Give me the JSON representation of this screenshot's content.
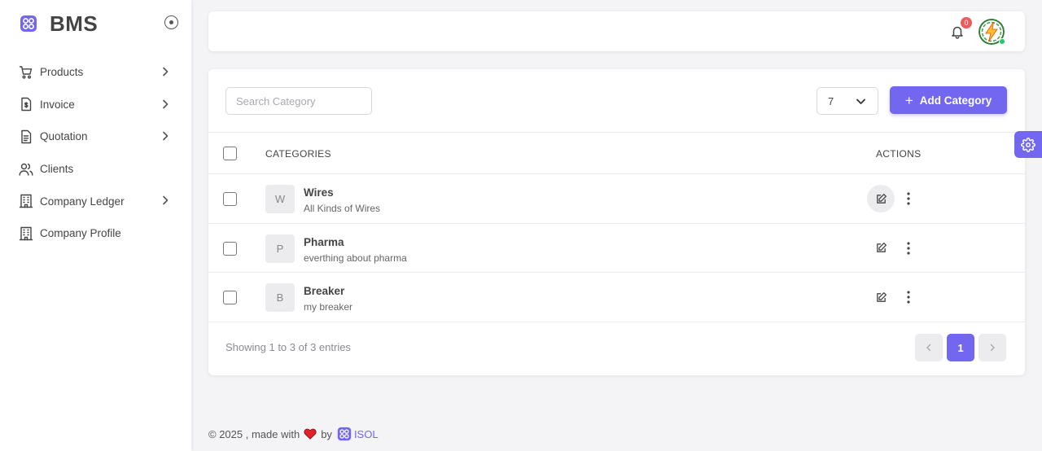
{
  "brand": {
    "name": "BMS"
  },
  "colors": {
    "primary": "#7367f0",
    "danger": "#ef5b5b",
    "success": "#28c76f"
  },
  "sidebar": {
    "items": [
      {
        "label": "Products",
        "icon": "cart-icon",
        "has_submenu": true
      },
      {
        "label": "Invoice",
        "icon": "invoice-icon",
        "has_submenu": true
      },
      {
        "label": "Quotation",
        "icon": "document-icon",
        "has_submenu": true
      },
      {
        "label": "Clients",
        "icon": "users-icon",
        "has_submenu": false
      },
      {
        "label": "Company Ledger",
        "icon": "building-icon",
        "has_submenu": true
      },
      {
        "label": "Company Profile",
        "icon": "building-icon",
        "has_submenu": false
      }
    ]
  },
  "header": {
    "notification_count": "0"
  },
  "toolbar": {
    "search_placeholder": "Search Category",
    "page_size": "7",
    "add_label": "Add Category"
  },
  "table": {
    "columns": {
      "categories": "CATEGORIES",
      "actions": "ACTIONS"
    },
    "rows": [
      {
        "initial": "W",
        "name": "Wires",
        "description": "All Kinds of Wires"
      },
      {
        "initial": "P",
        "name": "Pharma",
        "description": "everthing about pharma"
      },
      {
        "initial": "B",
        "name": "Breaker",
        "description": "my breaker"
      }
    ]
  },
  "pagination": {
    "summary": "Showing 1 to 3 of 3 entries",
    "current_page": "1"
  },
  "footer": {
    "prefix": "© 2025 , made with",
    "by": "by",
    "company": "ISOL"
  }
}
